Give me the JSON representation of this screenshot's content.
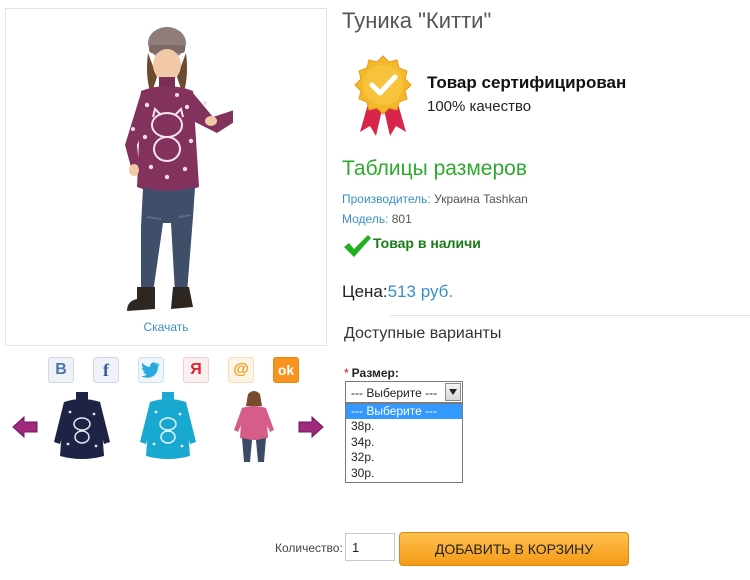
{
  "product": {
    "title": "Туника \"Китти\"",
    "manufacturer_label": "Производитель:",
    "manufacturer_value": "Украина Tashkan",
    "model_label": "Модель:",
    "model_value": "801",
    "stock_status": "Товар в наличи",
    "price_label": "Цена:",
    "price_value": "513 руб."
  },
  "gallery": {
    "download_label": "Скачать",
    "thumbnails": [
      "navy-sweater-thumbnail",
      "turquoise-sweater-thumbnail",
      "pink-sweater-thumbnail"
    ]
  },
  "share": {
    "vk": "В",
    "facebook": "f",
    "moimir": "Я",
    "mailru": "@",
    "odnoklassniki": "ok"
  },
  "certificate": {
    "title": "Товар сертифицирован",
    "subtitle": "100% качество"
  },
  "size_table_link": "Таблицы размеров",
  "options": {
    "section_title": "Доступные варианты",
    "required_mark": "*",
    "size_label": "Размер:",
    "selected": "--- Выберите ---",
    "choices": [
      "--- Выберите ---",
      "38р.",
      "34р.",
      "32р.",
      "30р."
    ]
  },
  "cart": {
    "quantity_label": "Количество:",
    "quantity_value": "1",
    "add_button": "ДОБАВИТЬ В КОРЗИНУ"
  },
  "colors": {
    "link_blue": "#3a8fc7",
    "size_table_green": "#2eaa2e",
    "in_stock_green": "#1a7a1a",
    "cart_orange": "#f59a16",
    "arrow_purple": "#a0287f"
  }
}
